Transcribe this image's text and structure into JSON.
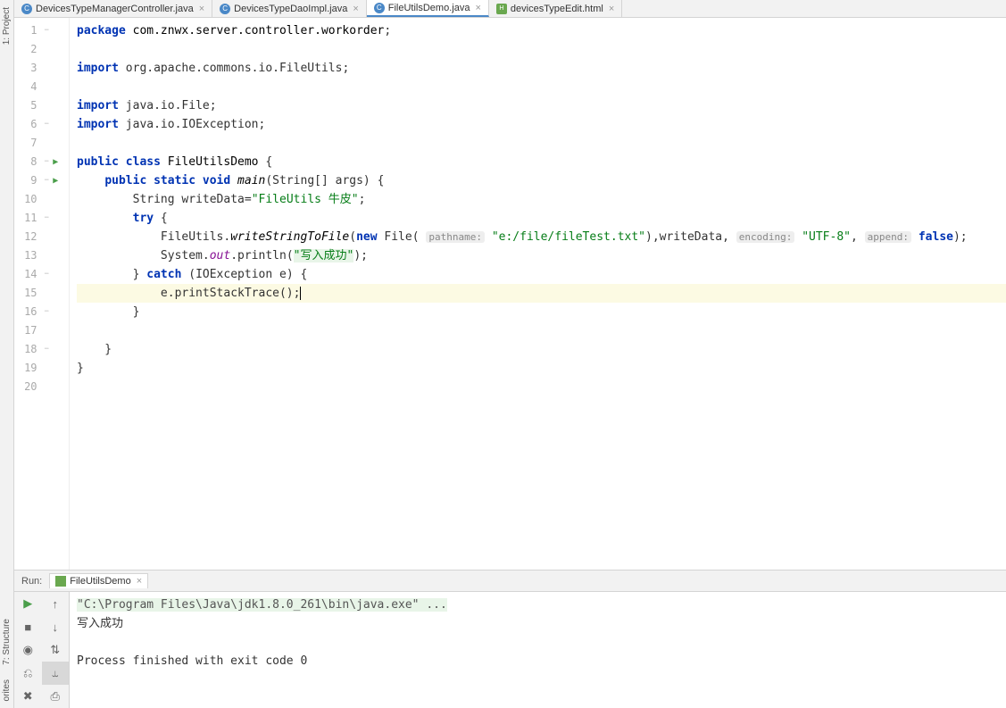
{
  "tabs": [
    {
      "icon": "C",
      "iconClass": "",
      "label": "DevicesTypeManagerController.java",
      "active": false
    },
    {
      "icon": "C",
      "iconClass": "",
      "label": "DevicesTypeDaoImpl.java",
      "active": false
    },
    {
      "icon": "C",
      "iconClass": "",
      "label": "FileUtilsDemo.java",
      "active": true
    },
    {
      "icon": "H",
      "iconClass": "html",
      "label": "devicesTypeEdit.html",
      "active": false
    }
  ],
  "rails": {
    "project": "1: Project",
    "structure": "7: Structure",
    "favorites": "orites"
  },
  "gutter": [
    {
      "n": "1",
      "fold": "−",
      "run": ""
    },
    {
      "n": "2",
      "fold": "",
      "run": ""
    },
    {
      "n": "3",
      "fold": "",
      "run": ""
    },
    {
      "n": "4",
      "fold": "",
      "run": ""
    },
    {
      "n": "5",
      "fold": "",
      "run": ""
    },
    {
      "n": "6",
      "fold": "−",
      "run": ""
    },
    {
      "n": "7",
      "fold": "",
      "run": ""
    },
    {
      "n": "8",
      "fold": "−",
      "run": "▶"
    },
    {
      "n": "9",
      "fold": "−",
      "run": "▶"
    },
    {
      "n": "10",
      "fold": "",
      "run": ""
    },
    {
      "n": "11",
      "fold": "−",
      "run": ""
    },
    {
      "n": "12",
      "fold": "",
      "run": ""
    },
    {
      "n": "13",
      "fold": "",
      "run": ""
    },
    {
      "n": "14",
      "fold": "−",
      "run": ""
    },
    {
      "n": "15",
      "fold": "",
      "run": ""
    },
    {
      "n": "16",
      "fold": "−",
      "run": ""
    },
    {
      "n": "17",
      "fold": "",
      "run": ""
    },
    {
      "n": "18",
      "fold": "−",
      "run": ""
    },
    {
      "n": "19",
      "fold": "",
      "run": ""
    },
    {
      "n": "20",
      "fold": "",
      "run": ""
    }
  ],
  "code": {
    "kw_package": "package",
    "pkg_name": "com.znwx.server.controller.workorder",
    "kw_import": "import",
    "imp1": "org.apache.commons.io.FileUtils",
    "imp2": "java.io.File",
    "imp3": "java.io.IOException",
    "kw_public": "public",
    "kw_class": "class",
    "cls_name": "FileUtilsDemo",
    "kw_static": "static",
    "kw_void": "void",
    "mth_main": "main",
    "args": "(String[] args)",
    "type_string": "String",
    "var_writeData": "writeData",
    "str_writeData": "\"FileUtils 牛皮\"",
    "kw_try": "try",
    "fileutils": "FileUtils",
    "mth_write": "writeStringToFile",
    "kw_new": "new",
    "cls_file": "File",
    "hint_pathname": "pathname:",
    "str_path": "\"e:/file/fileTest.txt\"",
    "var_wd2": "writeData",
    "hint_encoding": "encoding:",
    "str_enc": "\"UTF-8\"",
    "hint_append": "append:",
    "kw_false": "false",
    "system": "System",
    "out": "out",
    "println": "println",
    "str_success": "\"写入成功\"",
    "kw_catch": "catch",
    "ioex": "(IOException e)",
    "e_pst": "e.printStackTrace();"
  },
  "run": {
    "header_label": "Run:",
    "tab_label": "FileUtilsDemo",
    "cmd": "\"C:\\Program Files\\Java\\jdk1.8.0_261\\bin\\java.exe\" ...",
    "out1": "写入成功",
    "out2": "",
    "out3": "Process finished with exit code 0"
  },
  "tools": {
    "rerun": "▶",
    "up": "↑",
    "stop": "■",
    "down": "↓",
    "cam": "◉",
    "filter": "⇅",
    "exit": "⎌",
    "wrap": "⥿",
    "trash": "✖",
    "print": "⎙"
  }
}
